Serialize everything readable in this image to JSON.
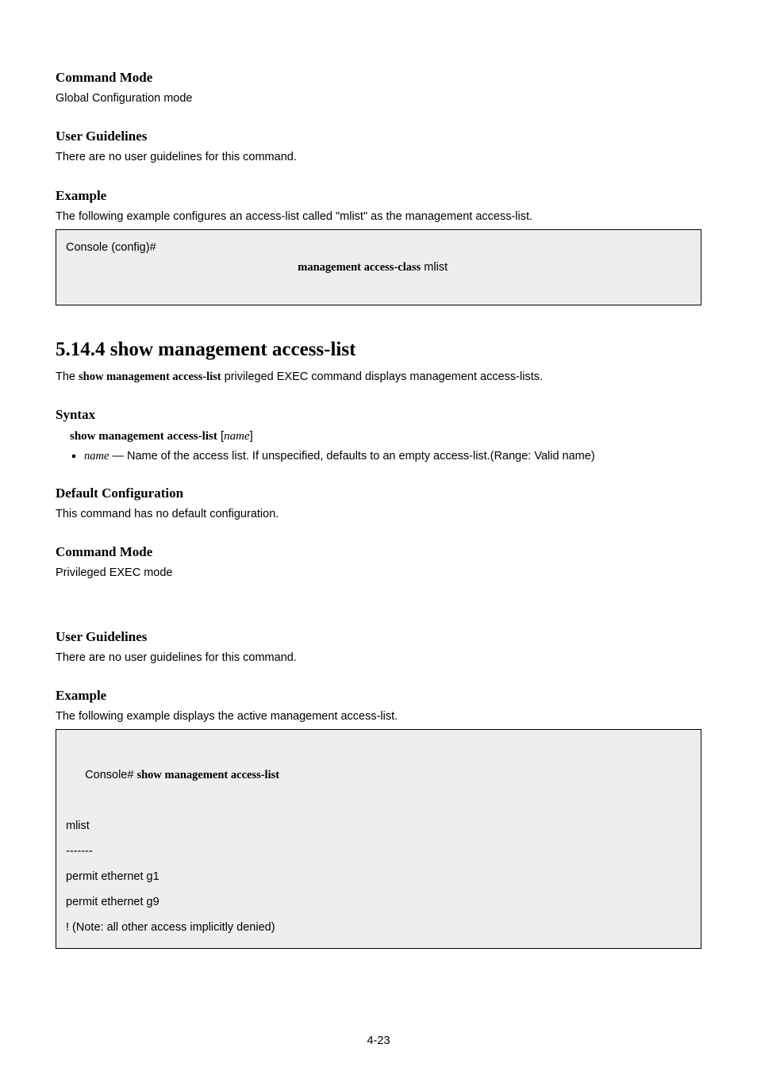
{
  "sectionA": {
    "commandModeHeading": "Command Mode",
    "commandModeText": "Global Configuration mode",
    "userGuidelinesHeading": "User Guidelines",
    "userGuidelinesText": "There are no user guidelines for this command.",
    "exampleHeading": "Example",
    "exampleText": "The following example configures an access-list called \"mlist\" as the management access-list.",
    "codePrompt": "Console (config)# ",
    "codeKeyword": "management access-class",
    "codeArg": " mlist"
  },
  "sectionB": {
    "title": "5.14.4 show management access-list",
    "descPrefix": "The ",
    "descKeyword": "show management access-list",
    "descSuffix": " privileged EXEC command displays management access-lists.",
    "syntaxHeading": "Syntax",
    "syntaxKeyword": "show management access-list",
    "syntaxBracketOpen": " [",
    "syntaxParam": "name",
    "syntaxBracketClose": "]",
    "paramName": "name",
    "paramDesc": " — Name of the access list. If unspecified, defaults to an empty access-list.(Range: Valid name)",
    "defaultHeading": "Default Configuration",
    "defaultText": "This command has no default configuration.",
    "commandModeHeading": "Command Mode",
    "commandModeText": "Privileged EXEC mode",
    "userGuidelinesHeading": "User Guidelines",
    "userGuidelinesText": "There are no user guidelines for this command.",
    "exampleHeading": "Example",
    "exampleText": "The following example displays the active management access-list.",
    "outPrompt": "Console# ",
    "outKeyword": "show management access-list",
    "outLine1": "mlist",
    "outLine2": "-------",
    "outLine3": "permit ethernet g1",
    "outLine4": "permit ethernet g9",
    "outLine5": "! (Note: all other access implicitly denied)"
  },
  "pageNumber": "4-23"
}
